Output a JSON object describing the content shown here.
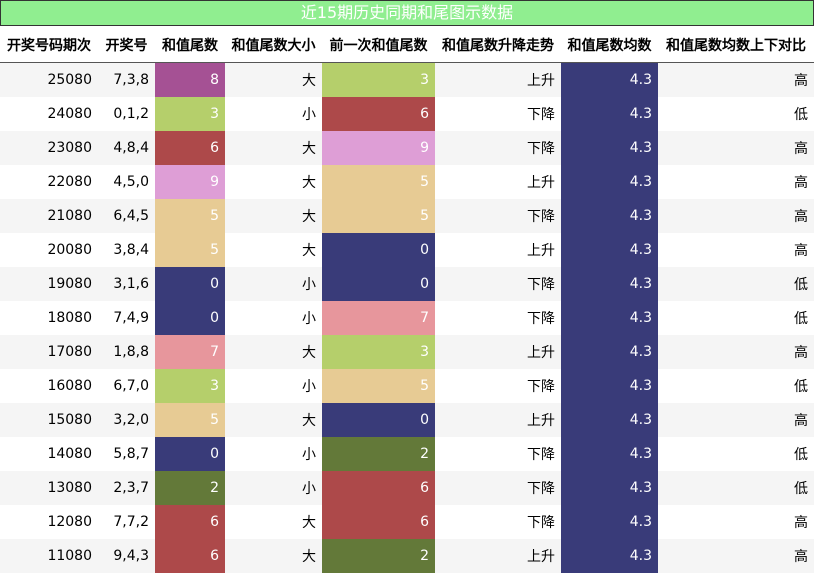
{
  "title": "近15期历史同期和尾图示数据",
  "colors": {
    "header_bg": "#90ee90",
    "avg_bg": "#393b79",
    "digit_colors": {
      "0": "#393b79",
      "2": "#637939",
      "3": "#b5cf6b",
      "5": "#e7cb94",
      "6": "#ad494a",
      "7": "#e7969c",
      "8": "#a55194",
      "9": "#de9ed6"
    }
  },
  "chart_data": {
    "type": "table",
    "title": "近15期历史同期和尾图示数据",
    "columns": [
      "开奖号码期次",
      "开奖号",
      "和值尾数",
      "和值尾数大小",
      "前一次和值尾数",
      "和值尾数升降走势",
      "和值尾数均数",
      "和值尾数均数上下对比"
    ],
    "rows": [
      [
        "25080",
        "7,3,8",
        "8",
        "大",
        "3",
        "上升",
        "4.3",
        "高"
      ],
      [
        "24080",
        "0,1,2",
        "3",
        "小",
        "6",
        "下降",
        "4.3",
        "低"
      ],
      [
        "23080",
        "4,8,4",
        "6",
        "大",
        "9",
        "下降",
        "4.3",
        "高"
      ],
      [
        "22080",
        "4,5,0",
        "9",
        "大",
        "5",
        "上升",
        "4.3",
        "高"
      ],
      [
        "21080",
        "6,4,5",
        "5",
        "大",
        "5",
        "下降",
        "4.3",
        "高"
      ],
      [
        "20080",
        "3,8,4",
        "5",
        "大",
        "0",
        "上升",
        "4.3",
        "高"
      ],
      [
        "19080",
        "3,1,6",
        "0",
        "小",
        "0",
        "下降",
        "4.3",
        "低"
      ],
      [
        "18080",
        "7,4,9",
        "0",
        "小",
        "7",
        "下降",
        "4.3",
        "低"
      ],
      [
        "17080",
        "1,8,8",
        "7",
        "大",
        "3",
        "上升",
        "4.3",
        "高"
      ],
      [
        "16080",
        "6,7,0",
        "3",
        "小",
        "5",
        "下降",
        "4.3",
        "低"
      ],
      [
        "15080",
        "3,2,0",
        "5",
        "大",
        "0",
        "上升",
        "4.3",
        "高"
      ],
      [
        "14080",
        "5,8,7",
        "0",
        "小",
        "2",
        "下降",
        "4.3",
        "低"
      ],
      [
        "13080",
        "2,3,7",
        "2",
        "小",
        "6",
        "下降",
        "4.3",
        "低"
      ],
      [
        "12080",
        "7,7,2",
        "6",
        "大",
        "6",
        "下降",
        "4.3",
        "高"
      ],
      [
        "11080",
        "9,4,3",
        "6",
        "大",
        "2",
        "上升",
        "4.3",
        "高"
      ]
    ]
  }
}
